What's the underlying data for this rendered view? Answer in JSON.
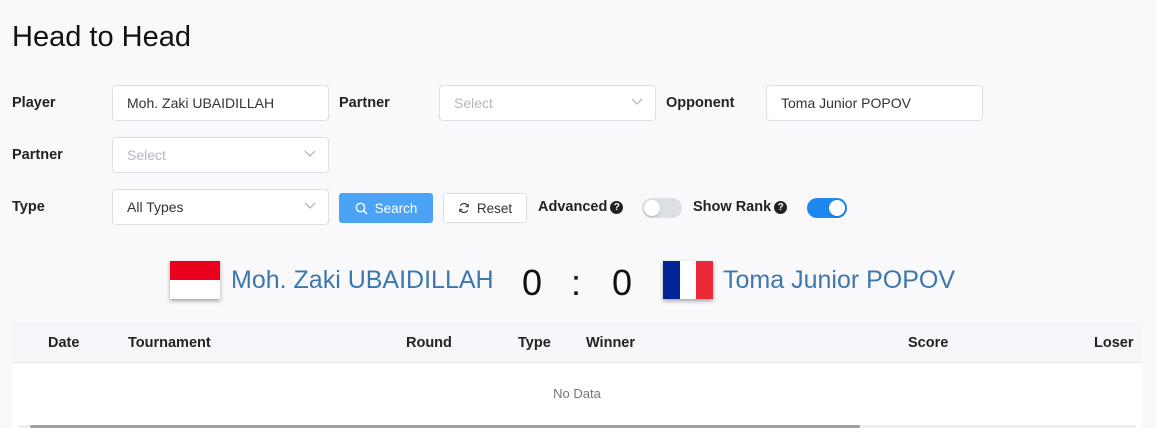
{
  "page": {
    "title": "Head to Head"
  },
  "filters": {
    "player": {
      "label": "Player",
      "value": "Moh. Zaki UBAIDILLAH"
    },
    "partner1": {
      "label": "Partner",
      "placeholder": "Select"
    },
    "opponent": {
      "label": "Opponent",
      "value": "Toma Junior POPOV"
    },
    "partner2": {
      "label": "Partner",
      "placeholder": "Select"
    },
    "type": {
      "label": "Type",
      "value": "All Types"
    },
    "search_label": "Search",
    "reset_label": "Reset",
    "advanced": {
      "label": "Advanced",
      "help": "?",
      "enabled": false
    },
    "show_rank": {
      "label": "Show Rank",
      "help": "?",
      "enabled": true
    }
  },
  "matchup": {
    "player1": {
      "name": "Moh. Zaki UBAIDILLAH",
      "flag": "indonesia-flag"
    },
    "player2": {
      "name": "Toma Junior POPOV",
      "flag": "france-flag"
    },
    "score1": "0",
    "separator": ":",
    "score2": "0"
  },
  "table": {
    "columns": [
      "Date",
      "Tournament",
      "Round",
      "Type",
      "Winner",
      "Score",
      "Loser"
    ],
    "empty_text": "No Data"
  },
  "colors": {
    "accent": "#4ba3f5",
    "toggle_on": "#1e88f0",
    "player_name": "#3c77ad",
    "indonesia_red": "#e8001c",
    "france_blue": "#002395",
    "france_red": "#ed2939"
  }
}
